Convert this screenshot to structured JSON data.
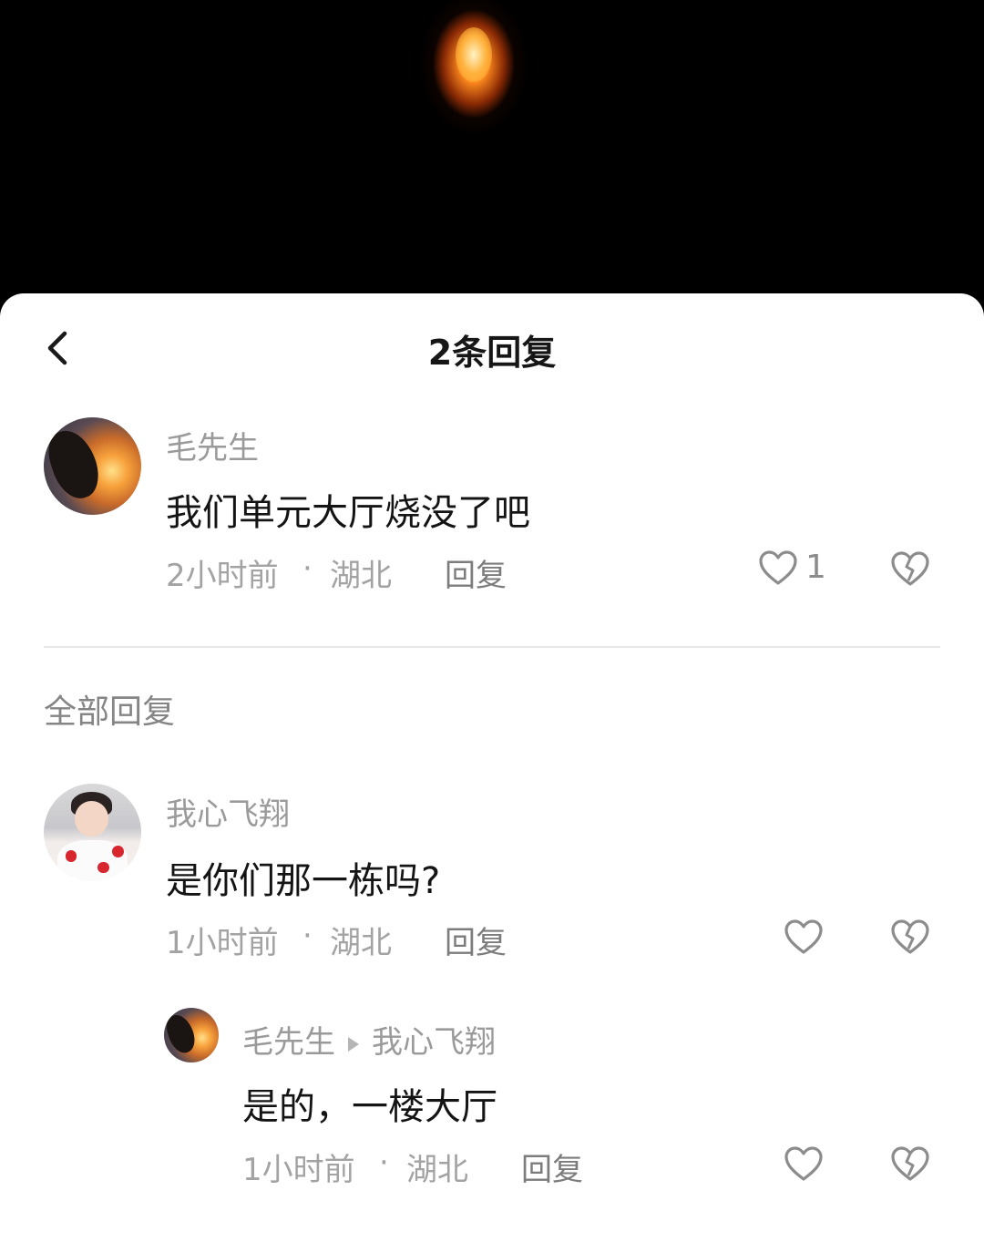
{
  "header": {
    "title": "2条回复"
  },
  "main_comment": {
    "author": "毛先生",
    "text": "我们单元大厅烧没了吧",
    "time": "2小时前",
    "separator": "·",
    "location": "湖北",
    "reply_label": "回复",
    "likes": "1"
  },
  "section": {
    "label": "全部回复"
  },
  "replies": [
    {
      "author": "我心飞翔",
      "text": "是你们那一栋吗?",
      "time": "1小时前",
      "separator": "·",
      "location": "湖北",
      "reply_label": "回复"
    },
    {
      "author": "毛先生",
      "reply_to": "我心飞翔",
      "text": "是的，一楼大厅",
      "time": "1小时前",
      "separator": "·",
      "location": "湖北",
      "reply_label": "回复"
    }
  ],
  "colors": {
    "sheet_bg": "#ffffff",
    "name_gray": "#9a9a9a",
    "text_dark": "#141414"
  }
}
